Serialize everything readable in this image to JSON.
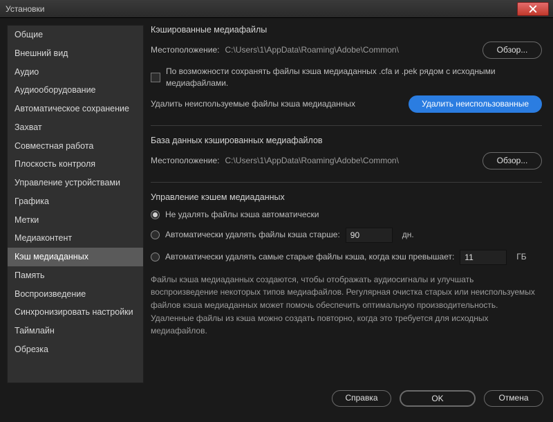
{
  "window": {
    "title": "Установки"
  },
  "sidebar": {
    "items": [
      "Общие",
      "Внешний вид",
      "Аудио",
      "Аудиооборудование",
      "Автоматическое сохранение",
      "Захват",
      "Совместная работа",
      "Плоскость контроля",
      "Управление устройствами",
      "Графика",
      "Метки",
      "Медиаконтент",
      "Кэш медиаданных",
      "Память",
      "Воспроизведение",
      "Синхронизировать настройки",
      "Таймлайн",
      "Обрезка"
    ],
    "selected_index": 12
  },
  "cache_files": {
    "title": "Кэшированные медиафайлы",
    "location_label": "Местоположение:",
    "location_value": "C:\\Users\\1\\AppData\\Roaming\\Adobe\\Common\\",
    "browse": "Обзор...",
    "save_alongside": "По возможности сохранять файлы кэша медиаданных .cfa и .pek рядом с исходными медиафайлами.",
    "delete_unused_label": "Удалить неиспользуемые файлы кэша медиаданных",
    "delete_unused_button": "Удалить неиспользованные"
  },
  "cache_db": {
    "title": "База данных кэшированных медиафайлов",
    "location_label": "Местоположение:",
    "location_value": "C:\\Users\\1\\AppData\\Roaming\\Adobe\\Common\\",
    "browse": "Обзор..."
  },
  "cache_mgmt": {
    "title": "Управление кэшем медиаданных",
    "opt_none": "Не удалять файлы кэша автоматически",
    "opt_age": "Автоматически удалять файлы кэша старше:",
    "age_value": "90",
    "age_unit": "дн.",
    "opt_size": "Автоматически удалять самые старые файлы кэша, когда кэш превышает:",
    "size_value": "11",
    "size_unit": "ГБ",
    "help": "Файлы кэша медиаданных создаются, чтобы отображать аудиосигналы и улучшать воспроизведение некоторых типов медиафайлов. Регулярная очистка старых или неиспользуемых файлов кэша медиаданных может помочь обеспечить оптимальную производительность. Удаленные файлы из кэша можно создать повторно, когда это требуется для исходных медиафайлов."
  },
  "footer": {
    "help": "Справка",
    "ok": "OK",
    "cancel": "Отмена"
  }
}
